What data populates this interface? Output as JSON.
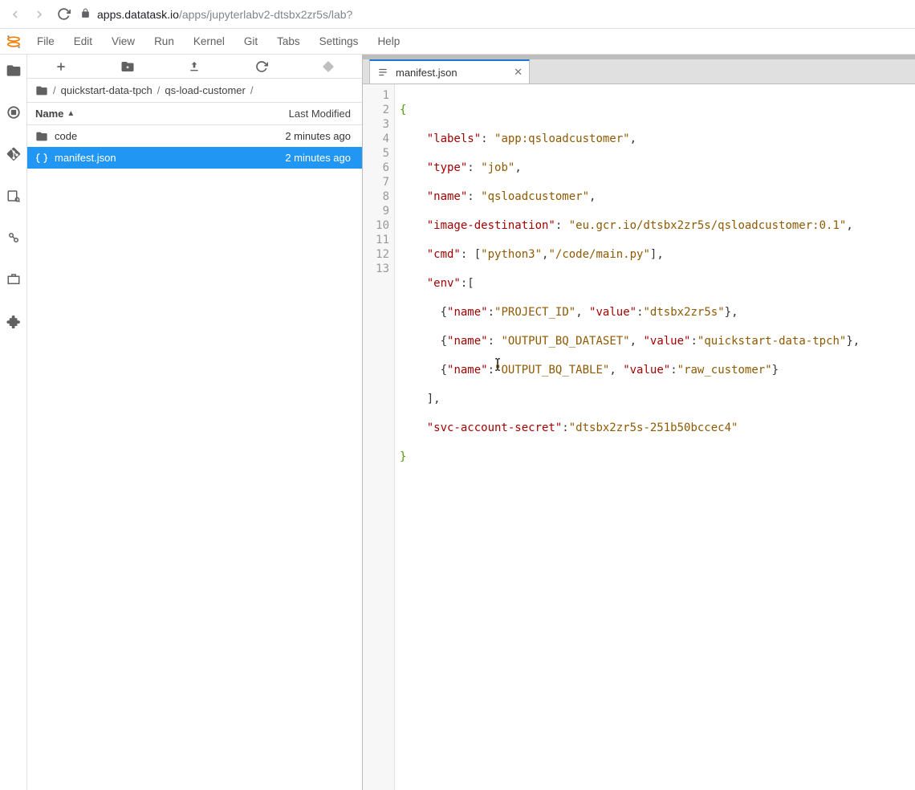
{
  "browser": {
    "url_host": "apps.datatask.io",
    "url_path": "/apps/jupyterlabv2-dtsbx2zr5s/lab?"
  },
  "menu": {
    "file": "File",
    "edit": "Edit",
    "view": "View",
    "run": "Run",
    "kernel": "Kernel",
    "git": "Git",
    "tabs": "Tabs",
    "settings": "Settings",
    "help": "Help"
  },
  "breadcrumb": {
    "seg1": "quickstart-data-tpch",
    "seg2": "qs-load-customer"
  },
  "filecols": {
    "name": "Name",
    "modified": "Last Modified"
  },
  "files": [
    {
      "name": "code",
      "modified": "2 minutes ago",
      "type": "folder"
    },
    {
      "name": "manifest.json",
      "modified": "2 minutes ago",
      "type": "json"
    }
  ],
  "tab": {
    "title": "manifest.json"
  },
  "code": {
    "k_labels": "\"labels\"",
    "v_labels": "\"app:qsloadcustomer\"",
    "k_type": "\"type\"",
    "v_type": "\"job\"",
    "k_name": "\"name\"",
    "v_name": "\"qsloadcustomer\"",
    "k_imgdest": "\"image-destination\"",
    "v_imgdest": "\"eu.gcr.io/dtsbx2zr5s/qsloadcustomer:0.1\"",
    "k_cmd": "\"cmd\"",
    "v_cmd1": "\"python3\"",
    "v_cmd2": "\"/code/main.py\"",
    "k_env": "\"env\"",
    "k_n": "\"name\"",
    "k_v": "\"value\"",
    "e1n": "\"PROJECT_ID\"",
    "e1v": "\"dtsbx2zr5s\"",
    "e2n": "\"OUTPUT_BQ_DATASET\"",
    "e2v": "\"quickstart-data-tpch\"",
    "e3n": "\"OUTPUT_BQ_TABLE\"",
    "e3v": "\"raw_customer\"",
    "k_svc": "\"svc-account-secret\"",
    "v_svc": "\"dtsbx2zr5s-251b50bccec4\""
  },
  "linenums": [
    "1",
    "2",
    "3",
    "4",
    "5",
    "6",
    "7",
    "8",
    "9",
    "10",
    "11",
    "12",
    "13"
  ]
}
